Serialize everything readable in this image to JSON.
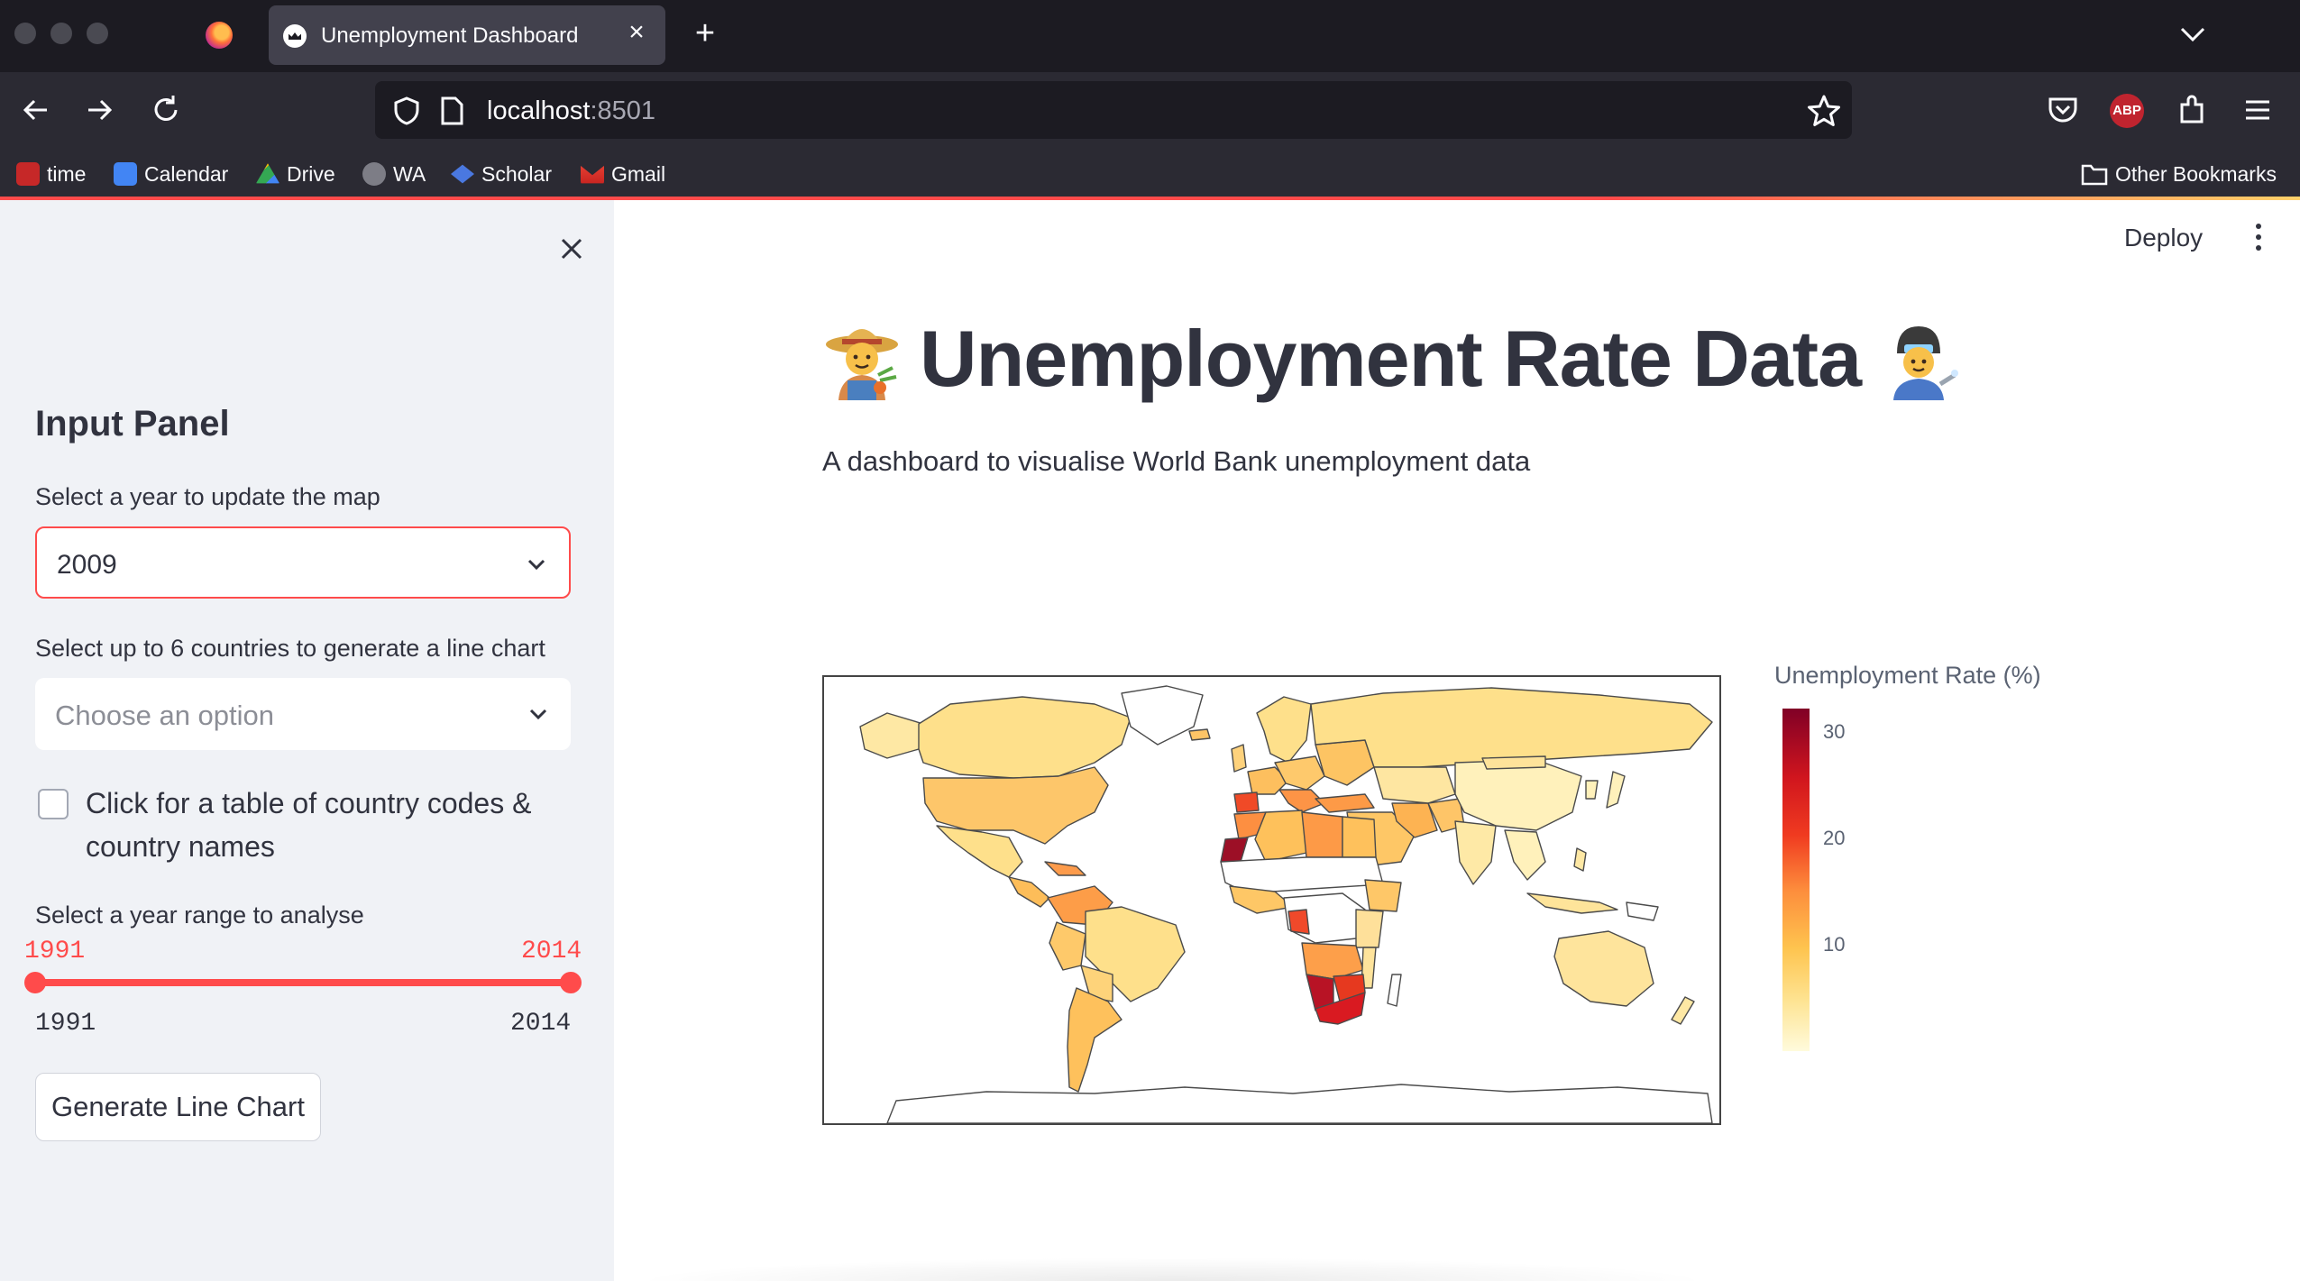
{
  "browser": {
    "tab_title": "Unemployment Dashboard",
    "url_host": "localhost",
    "url_port": ":8501",
    "bookmarks": [
      {
        "label": "time",
        "icon": "time-favicon",
        "color": "#c62828"
      },
      {
        "label": "Calendar",
        "icon": "calendar-favicon",
        "color": "#4285f4"
      },
      {
        "label": "Drive",
        "icon": "drive-favicon",
        "color": "#34a853"
      },
      {
        "label": "WA",
        "icon": "whatsapp-favicon",
        "color": "#7d7d86"
      },
      {
        "label": "Scholar",
        "icon": "scholar-favicon",
        "color": "#4a78e0"
      },
      {
        "label": "Gmail",
        "icon": "gmail-favicon",
        "color": "#ea4335"
      }
    ],
    "other_bookmarks": "Other Bookmarks",
    "abp_label": "ABP"
  },
  "sidebar": {
    "heading": "Input Panel",
    "year_select_label": "Select a year to update the map",
    "year_select_value": "2009",
    "countries_label": "Select up to 6 countries to generate a line chart",
    "countries_placeholder": "Choose an option",
    "checkbox_label": "Click for a table of country codes & country names",
    "checkbox_checked": false,
    "range_label": "Select a year range to analyse",
    "range_low": "1991",
    "range_high": "2014",
    "range_min": "1991",
    "range_max": "2014",
    "button_label": "Generate Line Chart"
  },
  "main": {
    "deploy_label": "Deploy",
    "title": "Unemployment Rate Data",
    "subtitle": "A dashboard to visualise World Bank unemployment data",
    "colorbar": {
      "title": "Unemployment Rate (%)",
      "ticks": [
        "30",
        "20",
        "10"
      ]
    }
  },
  "chart_data": {
    "type": "choropleth",
    "year": "2009",
    "colorscale": [
      "#fffbdc",
      "#fee391",
      "#fec44f",
      "#fd8d3c",
      "#f03b20",
      "#d0151e",
      "#800026"
    ],
    "colorbar_range": [
      0,
      32
    ]
  },
  "colors": {
    "accent": "#ff4b4b",
    "text": "#31333f",
    "sidebar_bg": "#f0f2f6"
  }
}
